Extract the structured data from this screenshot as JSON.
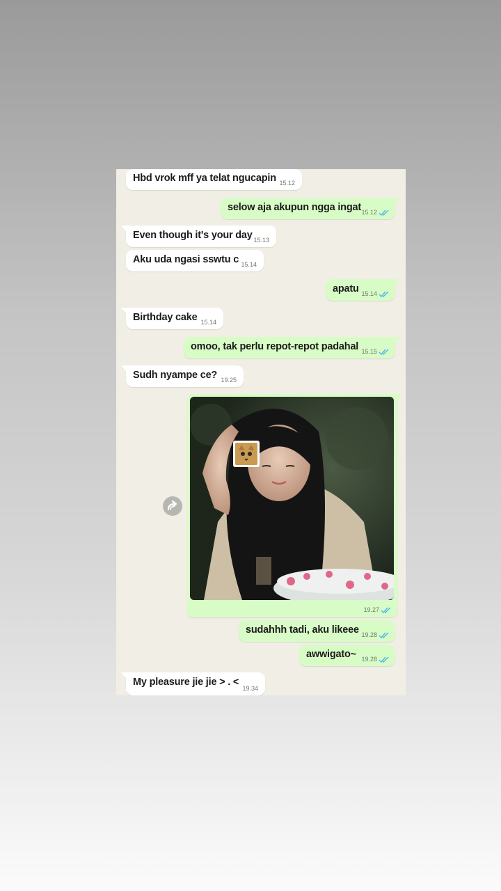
{
  "colors": {
    "incoming_bubble": "#ffffff",
    "outgoing_bubble": "#d8fcc6",
    "chat_background": "#f1eee6",
    "read_ticks": "#4fb6ec"
  },
  "messages": [
    {
      "direction": "incoming",
      "text": "Hbd vrok mff ya telat ngucapin",
      "time": "15.12"
    },
    {
      "direction": "outgoing",
      "text": "selow aja akupun ngga ingat",
      "time": "15.12",
      "status": "read"
    },
    {
      "direction": "incoming",
      "text": "Even though it's your day",
      "time": "15.13"
    },
    {
      "direction": "incoming",
      "text": "Aku uda ngasi sswtu c",
      "time": "15.14"
    },
    {
      "direction": "outgoing",
      "text": "apatu",
      "time": "15.14",
      "status": "read"
    },
    {
      "direction": "incoming",
      "text": "Birthday cake",
      "time": "15.14"
    },
    {
      "direction": "outgoing",
      "text": "omoo, tak perlu repot-repot padahal",
      "time": "15.15",
      "status": "read"
    },
    {
      "direction": "incoming",
      "text": "Sudh nyampe ce?",
      "time": "19.25"
    },
    {
      "direction": "outgoing",
      "type": "image",
      "time": "19.27",
      "status": "read"
    },
    {
      "direction": "outgoing",
      "text": "sudahhh tadi, aku likeee",
      "time": "19.28",
      "status": "read"
    },
    {
      "direction": "outgoing",
      "text": "awwigato~",
      "time": "19.28",
      "status": "read"
    },
    {
      "direction": "incoming",
      "text": "My pleasure jie jie > . <",
      "time": "19.34"
    }
  ],
  "icons": {
    "share": "forward-arrow-icon",
    "read_status": "double-check-icon",
    "sticker": "cat-sticker-icon"
  }
}
